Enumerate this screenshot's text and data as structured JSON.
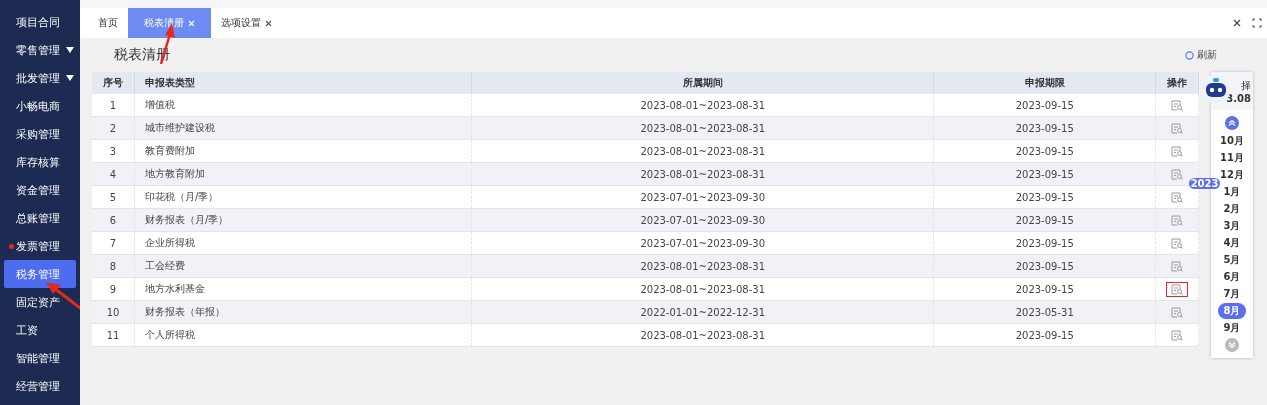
{
  "sidebar": {
    "items": [
      {
        "label": "项目合同",
        "expandable": false,
        "selected": false,
        "alert": false,
        "annotated": false
      },
      {
        "label": "零售管理",
        "expandable": true,
        "selected": false,
        "alert": false,
        "annotated": false
      },
      {
        "label": "批发管理",
        "expandable": true,
        "selected": false,
        "alert": false,
        "annotated": false
      },
      {
        "label": "小畅电商",
        "expandable": false,
        "selected": false,
        "alert": false,
        "annotated": false
      },
      {
        "label": "采购管理",
        "expandable": false,
        "selected": false,
        "alert": false,
        "annotated": false
      },
      {
        "label": "库存核算",
        "expandable": false,
        "selected": false,
        "alert": false,
        "annotated": false
      },
      {
        "label": "资金管理",
        "expandable": false,
        "selected": false,
        "alert": false,
        "annotated": false
      },
      {
        "label": "总账管理",
        "expandable": false,
        "selected": false,
        "alert": false,
        "annotated": false
      },
      {
        "label": "发票管理",
        "expandable": false,
        "selected": false,
        "alert": true,
        "annotated": false
      },
      {
        "label": "税务管理",
        "expandable": false,
        "selected": true,
        "alert": false,
        "annotated": true
      },
      {
        "label": "固定资产",
        "expandable": false,
        "selected": false,
        "alert": false,
        "annotated": false
      },
      {
        "label": "工资",
        "expandable": false,
        "selected": false,
        "alert": false,
        "annotated": false
      },
      {
        "label": "智能管理",
        "expandable": false,
        "selected": false,
        "alert": false,
        "annotated": false
      },
      {
        "label": "经营管理",
        "expandable": false,
        "selected": false,
        "alert": false,
        "annotated": false
      }
    ]
  },
  "tabs": [
    {
      "label": "首页",
      "closable": false,
      "selected": false,
      "annotated": false
    },
    {
      "label": "税表清册",
      "closable": true,
      "selected": true,
      "annotated": true
    },
    {
      "label": "选项设置",
      "closable": true,
      "selected": false,
      "annotated": false
    }
  ],
  "page": {
    "title": "税表清册",
    "refresh": "刷新"
  },
  "table": {
    "columns": [
      "序号",
      "申报表类型",
      "所属期间",
      "申报期限",
      "操作"
    ],
    "rows": [
      {
        "no": "1",
        "type": "增值税",
        "period": "2023-08-01~2023-08-31",
        "deadline": "2023-09-15",
        "highlighted": false
      },
      {
        "no": "2",
        "type": "城市维护建设税",
        "period": "2023-08-01~2023-08-31",
        "deadline": "2023-09-15",
        "highlighted": false
      },
      {
        "no": "3",
        "type": "教育费附加",
        "period": "2023-08-01~2023-08-31",
        "deadline": "2023-09-15",
        "highlighted": false
      },
      {
        "no": "4",
        "type": "地方教育附加",
        "period": "2023-08-01~2023-08-31",
        "deadline": "2023-09-15",
        "highlighted": false
      },
      {
        "no": "5",
        "type": "印花税（月/季）",
        "period": "2023-07-01~2023-09-30",
        "deadline": "2023-09-15",
        "highlighted": false
      },
      {
        "no": "6",
        "type": "财务报表（月/季）",
        "period": "2023-07-01~2023-09-30",
        "deadline": "2023-09-15",
        "highlighted": false
      },
      {
        "no": "7",
        "type": "企业所得税",
        "period": "2023-07-01~2023-09-30",
        "deadline": "2023-09-15",
        "highlighted": false
      },
      {
        "no": "8",
        "type": "工会经费",
        "period": "2023-08-01~2023-08-31",
        "deadline": "2023-09-15",
        "highlighted": false
      },
      {
        "no": "9",
        "type": "地方水利基金",
        "period": "2023-08-01~2023-08-31",
        "deadline": "2023-09-15",
        "highlighted": true
      },
      {
        "no": "10",
        "type": "财务报表（年报）",
        "period": "2022-01-01~2022-12-31",
        "deadline": "2023-05-31",
        "highlighted": false
      },
      {
        "no": "11",
        "type": "个人所得税",
        "period": "2023-08-01~2023-08-31",
        "deadline": "2023-09-15",
        "highlighted": false
      }
    ]
  },
  "period_picker": {
    "label": "择",
    "current": "3.08",
    "months": [
      {
        "label": "10月",
        "selected": false
      },
      {
        "label": "11月",
        "selected": false
      },
      {
        "label": "12月",
        "selected": false
      },
      {
        "label": "1月",
        "selected": false,
        "year": "2023"
      },
      {
        "label": "2月",
        "selected": false
      },
      {
        "label": "3月",
        "selected": false
      },
      {
        "label": "4月",
        "selected": false
      },
      {
        "label": "5月",
        "selected": false
      },
      {
        "label": "6月",
        "selected": false
      },
      {
        "label": "7月",
        "selected": false
      },
      {
        "label": "8月",
        "selected": true
      },
      {
        "label": "9月",
        "selected": false
      }
    ]
  }
}
